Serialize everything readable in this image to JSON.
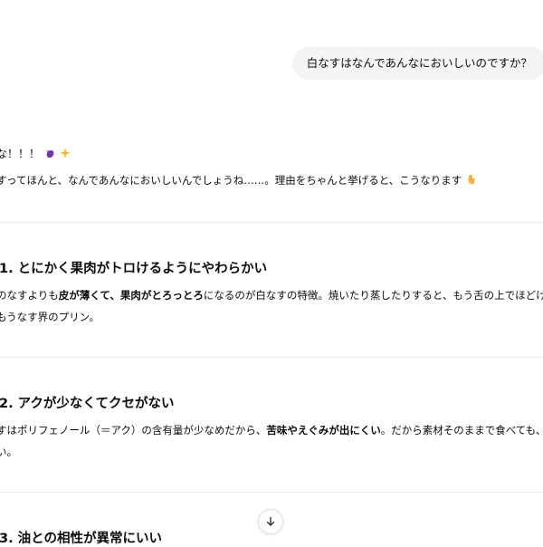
{
  "user_message": "白なすはなんであんなにおいしいのですか？",
  "response": {
    "lead_exclaim": "な！！！",
    "lead_text": "すってほんと、なんであんなにおいしいんでしょうね……。理由をちゃんと挙げると、こうなります",
    "sections": [
      {
        "heading": "1. とにかく果肉がトロけるようにやわらかい",
        "line1_a": "のなすよりも",
        "line1_b": "皮が薄くて、果肉がとろっとろ",
        "line1_c": "になるのが白なすの特徴。焼いたり蒸したりすると、もう舌の上でほどける…",
        "line2": "もうなす界のプリン。"
      },
      {
        "heading": "2. アクが少なくてクセがない",
        "line1_a": "すはポリフェノール（＝アク）の含有量が少なめだから、",
        "line1_b": "苦味やえぐみが出にくい",
        "line1_c": "。だから素材そのままで食べても、じん",
        "line2": "い。"
      },
      {
        "heading": "3. 油との相性が異常にいい"
      }
    ]
  },
  "icons": {
    "eggplant": "eggplant-emoji",
    "sparkles": "sparkles-emoji",
    "pointing": "pointing-down-emoji",
    "scroll": "arrow-down-icon"
  },
  "colors": {
    "bubble_bg": "#f4f4f4",
    "text": "#0d0d0d",
    "divider": "#ececec",
    "eggplant": "#7b2fb5",
    "sparkle": "#f5b800",
    "hand": "#f2b33d"
  }
}
